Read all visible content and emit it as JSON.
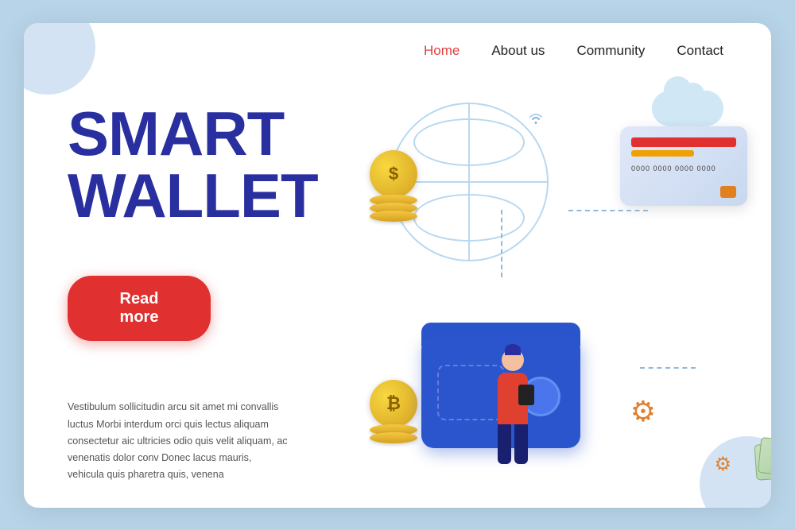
{
  "page": {
    "title": "Smart Wallet",
    "background_color": "#b8d4e8",
    "card_background": "#ffffff"
  },
  "navbar": {
    "links": [
      {
        "label": "Home",
        "active": true,
        "color": "#e04040"
      },
      {
        "label": "About us",
        "active": false,
        "color": "#222"
      },
      {
        "label": "Community",
        "active": false,
        "color": "#222"
      },
      {
        "label": "Contact",
        "active": false,
        "color": "#222"
      }
    ]
  },
  "hero": {
    "title_line1": "SMART",
    "title_line2": "WALLET",
    "read_more_label": "Read more",
    "body_text": "Vestibulum sollicitudin arcu sit amet mi convallis luctus Morbi interdum orci quis lectus aliquam consectetur aic ultricies odio quis velit aliquam, ac venenatis dolor conv Donec lacus mauris, vehicula quis pharetra quis, venena"
  },
  "illustration": {
    "coin_dollar_symbol": "$",
    "coin_bitcoin_symbol": "₿",
    "card_number": "0000 0000 0000 0000"
  }
}
